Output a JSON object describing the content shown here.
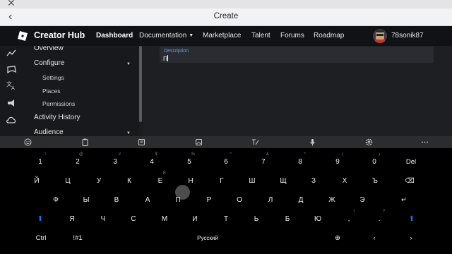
{
  "os": {
    "close_glyph": "✕"
  },
  "titlebar": {
    "back_glyph": "‹",
    "title": "Create"
  },
  "nav": {
    "brand": "Creator Hub",
    "links": [
      {
        "label": "Dashboard",
        "active": true
      },
      {
        "label": "Documentation",
        "has_caret": true
      },
      {
        "label": "Marketplace"
      },
      {
        "label": "Talent"
      },
      {
        "label": "Forums"
      },
      {
        "label": "Roadmap"
      }
    ],
    "username": "78sonik87"
  },
  "rail_icons": [
    "trending-icon",
    "controller-icon",
    "translate-icon",
    "megaphone-icon",
    "cloud-icon"
  ],
  "sidebar": {
    "items": [
      {
        "label": "Overview"
      },
      {
        "label": "Configure",
        "expanded": true
      },
      {
        "label": "Settings"
      },
      {
        "label": "Places"
      },
      {
        "label": "Permissions"
      },
      {
        "label": "Activity History"
      },
      {
        "label": "Audience",
        "expanded": true
      }
    ]
  },
  "form": {
    "description_label": "Description",
    "description_value": "П"
  },
  "keyboard": {
    "toolbar_icons": [
      "emoji-icon",
      "clipboard-icon",
      "keyboard-layout-icon",
      "image-icon",
      "handwriting-icon",
      "microphone-icon",
      "settings-icon",
      "more-icon"
    ],
    "row1": [
      {
        "k": "1",
        "h": "!"
      },
      {
        "k": "2",
        "h": "@"
      },
      {
        "k": "3",
        "h": "#"
      },
      {
        "k": "4",
        "h": "$"
      },
      {
        "k": "5",
        "h": "%"
      },
      {
        "k": "6",
        "h": "^"
      },
      {
        "k": "7",
        "h": "&"
      },
      {
        "k": "8",
        "h": "*"
      },
      {
        "k": "9",
        "h": "("
      },
      {
        "k": "0",
        "h": ")"
      },
      {
        "k": "Del",
        "h": ""
      }
    ],
    "row2": [
      {
        "k": "Й"
      },
      {
        "k": "Ц"
      },
      {
        "k": "У"
      },
      {
        "k": "К"
      },
      {
        "k": "Е",
        "h": "Ё"
      },
      {
        "k": "Н"
      },
      {
        "k": "Г"
      },
      {
        "k": "Ш"
      },
      {
        "k": "Щ"
      },
      {
        "k": "З"
      },
      {
        "k": "Х"
      },
      {
        "k": "Ъ"
      }
    ],
    "backspace_glyph": "⌫",
    "row3": [
      {
        "k": "Ф"
      },
      {
        "k": "Ы"
      },
      {
        "k": "В"
      },
      {
        "k": "А"
      },
      {
        "k": "П"
      },
      {
        "k": "Р"
      },
      {
        "k": "О"
      },
      {
        "k": "Л"
      },
      {
        "k": "Д"
      },
      {
        "k": "Ж"
      },
      {
        "k": "Э"
      }
    ],
    "enter_glyph": "↵",
    "row4": [
      {
        "k": "Я"
      },
      {
        "k": "Ч"
      },
      {
        "k": "С"
      },
      {
        "k": "М"
      },
      {
        "k": "И"
      },
      {
        "k": "Т"
      },
      {
        "k": "Ь"
      },
      {
        "k": "Б"
      },
      {
        "k": "Ю"
      },
      {
        "k": ",",
        "h": "!"
      },
      {
        "k": ".",
        "h": "?"
      }
    ],
    "shift_glyph": "⬆",
    "ctrl": "Ctrl",
    "symbols": "!#1",
    "space_label": "Русский",
    "globe_glyph": "⊕",
    "left_glyph": "‹",
    "right_glyph": "›"
  }
}
